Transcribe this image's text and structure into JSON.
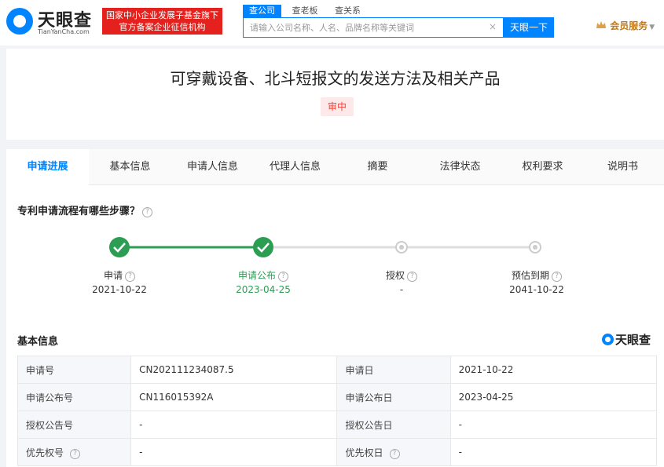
{
  "header": {
    "logo_text": "天眼查",
    "logo_sub": "TianYanCha.com",
    "banner_line1": "国家中小企业发展子基金旗下",
    "banner_line2": "官方备案企业征信机构",
    "search_tabs": [
      "查公司",
      "查老板",
      "查关系"
    ],
    "search_placeholder": "请输入公司名称、人名、品牌名称等关键词",
    "search_button": "天眼一下",
    "member_label": "会员服务"
  },
  "patent": {
    "title": "可穿戴设备、北斗短报文的发送方法及相关产品",
    "status": "审中"
  },
  "tabs": [
    "申请进展",
    "基本信息",
    "申请人信息",
    "代理人信息",
    "摘要",
    "法律状态",
    "权利要求",
    "说明书"
  ],
  "process": {
    "question": "专利申请流程有哪些步骤？",
    "steps": [
      {
        "label": "申请",
        "date": "2021-10-22",
        "done": true
      },
      {
        "label": "申请公布",
        "date": "2023-04-25",
        "done": true
      },
      {
        "label": "授权",
        "date": "-",
        "done": false
      },
      {
        "label": "预估到期",
        "date": "2041-10-22",
        "done": false
      }
    ]
  },
  "basic_info": {
    "title": "基本信息",
    "watermark": "天眼查",
    "rows": [
      [
        "申请号",
        "CN202111234087.5",
        "申请日",
        "2021-10-22"
      ],
      [
        "申请公布号",
        "CN116015392A",
        "申请公布日",
        "2023-04-25"
      ],
      [
        "授权公告号",
        "-",
        "授权公告日",
        "-"
      ],
      [
        "优先权号",
        "-",
        "优先权日",
        "-"
      ]
    ]
  },
  "colors": {
    "accent": "#0084ff",
    "done": "#2c9e54",
    "pending": "#cccccc",
    "status_red": "#e8483e"
  }
}
